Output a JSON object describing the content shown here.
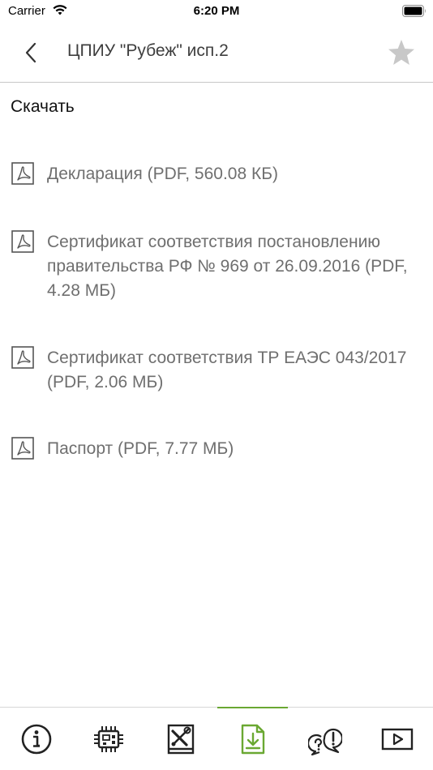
{
  "status_bar": {
    "carrier": "Carrier",
    "time": "6:20 PM"
  },
  "header": {
    "title": "ЦПИУ \"Рубеж\" исп.2",
    "back_icon": "chevron-left-icon",
    "favorite_icon": "star-icon"
  },
  "section": {
    "title": "Скачать"
  },
  "documents": [
    {
      "label": "Декларация (PDF, 560.08 КБ)",
      "icon": "pdf-icon"
    },
    {
      "label": "Сертификат соответствия постановлению правительства РФ № 969 от 26.09.2016 (PDF, 4.28 МБ)",
      "icon": "pdf-icon"
    },
    {
      "label": "Сертификат соответствия ТР ЕАЭС 043/2017 (PDF, 2.06 МБ)",
      "icon": "pdf-icon"
    },
    {
      "label": "Паспорт (PDF, 7.77 МБ)",
      "icon": "pdf-icon"
    }
  ],
  "tabs": [
    {
      "icon": "info-icon",
      "active": false
    },
    {
      "icon": "chip-icon",
      "active": false
    },
    {
      "icon": "tools-manual-icon",
      "active": false
    },
    {
      "icon": "download-file-icon",
      "active": true
    },
    {
      "icon": "question-bubbles-icon",
      "active": false
    },
    {
      "icon": "video-play-icon",
      "active": false
    }
  ],
  "colors": {
    "accent": "#6aa832",
    "text_secondary": "#6f6f6f",
    "title_text": "#3e3e3e",
    "star_inactive": "#c8c8c8"
  }
}
